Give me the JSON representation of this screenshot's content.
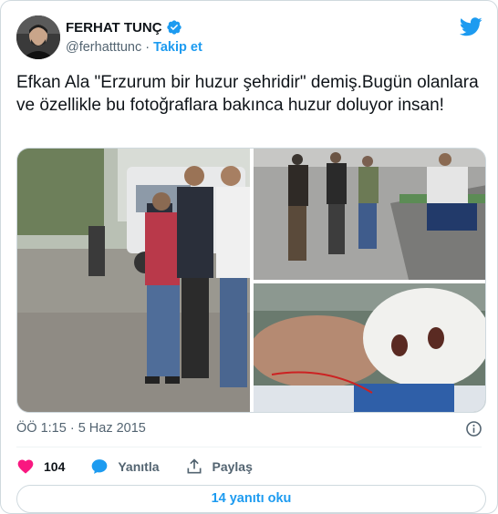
{
  "author": {
    "name": "FERHAT TUNÇ",
    "handle": "@ferhatttunc",
    "separator": "·",
    "follow_label": "Takip et"
  },
  "tweet": {
    "text": "Efkan Ala \"Erzurum bir huzur şehridir\" demiş.Bugün olanlara ve özellikle bu fotoğraflara bakınca huzur doluyor insan!"
  },
  "media": {
    "photo_count": 3
  },
  "timestamp": "ÖÖ 1:15 · 5 Haz 2015",
  "actions": {
    "like_count": "104",
    "reply_label": "Yanıtla",
    "share_label": "Paylaş"
  },
  "read_replies_label": "14 yanıtı oku",
  "colors": {
    "accent": "#1d9bf0",
    "like": "#f91880",
    "text": "#0f1419",
    "muted": "#536471",
    "border": "#cfd9de"
  },
  "icons": {
    "brand": "twitter-bird-icon",
    "verified": "verified-badge-icon",
    "info": "info-icon",
    "like": "heart-icon",
    "reply": "reply-bubble-icon",
    "share": "share-upload-icon"
  }
}
